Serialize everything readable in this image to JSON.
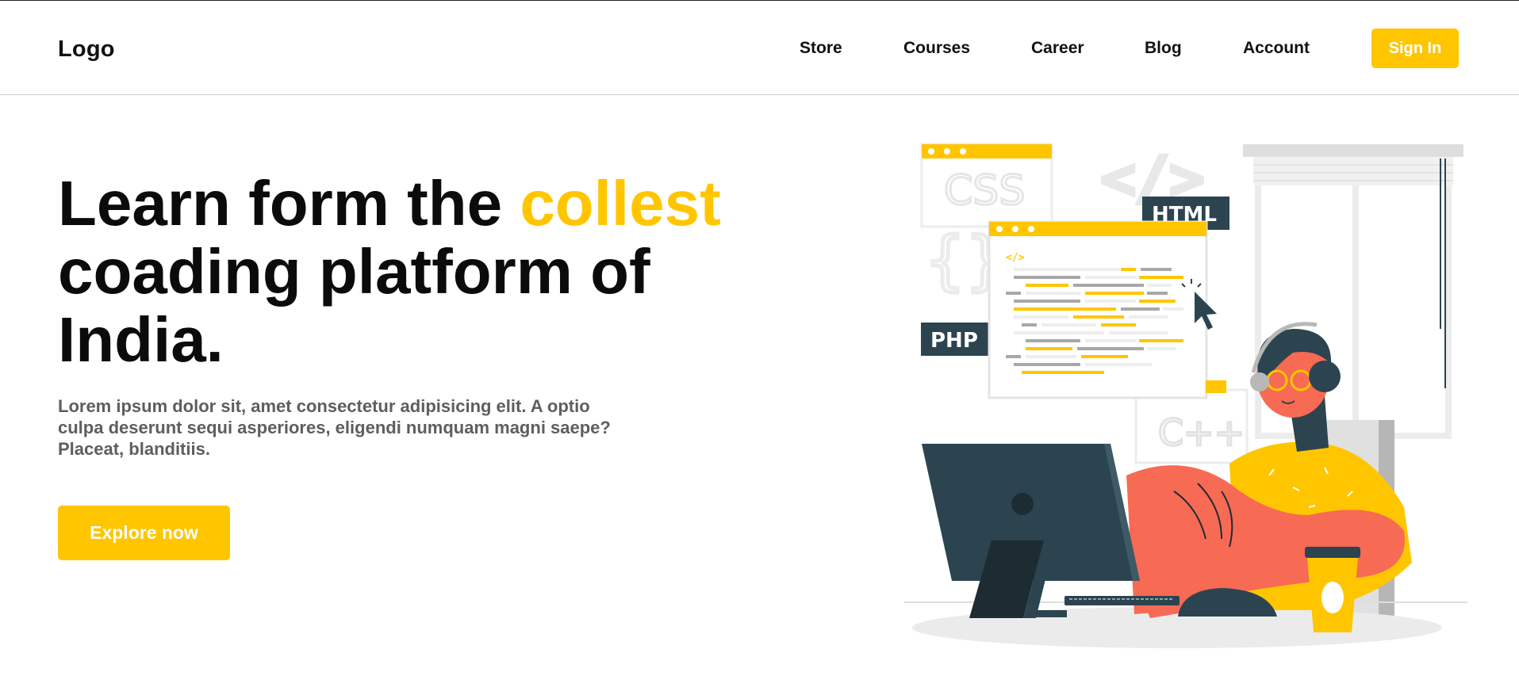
{
  "header": {
    "logo": "Logo",
    "nav": [
      {
        "label": "Store"
      },
      {
        "label": "Courses"
      },
      {
        "label": "Career"
      },
      {
        "label": "Blog"
      },
      {
        "label": "Account"
      }
    ],
    "signin_label": "Sign In"
  },
  "hero": {
    "title_part1": "Learn form the ",
    "title_accent": "collest",
    "title_part2": "coading platform of",
    "title_part3": "India.",
    "subtitle": "Lorem ipsum dolor sit, amet consectetur adipisicing elit. A optio culpa deserunt sequi asperiores, eligendi numquam magni saepe? Placeat, blanditiis.",
    "cta_label": "Explore now"
  },
  "illustration": {
    "tags": {
      "css": "CSS",
      "html": "HTML",
      "php": "PHP",
      "cpp": "C++",
      "code_open": "</>",
      "braces": "{}",
      "snippet": "</>"
    }
  },
  "colors": {
    "accent": "#ffc600",
    "dark": "#2c4450",
    "skin": "#f76a54"
  }
}
